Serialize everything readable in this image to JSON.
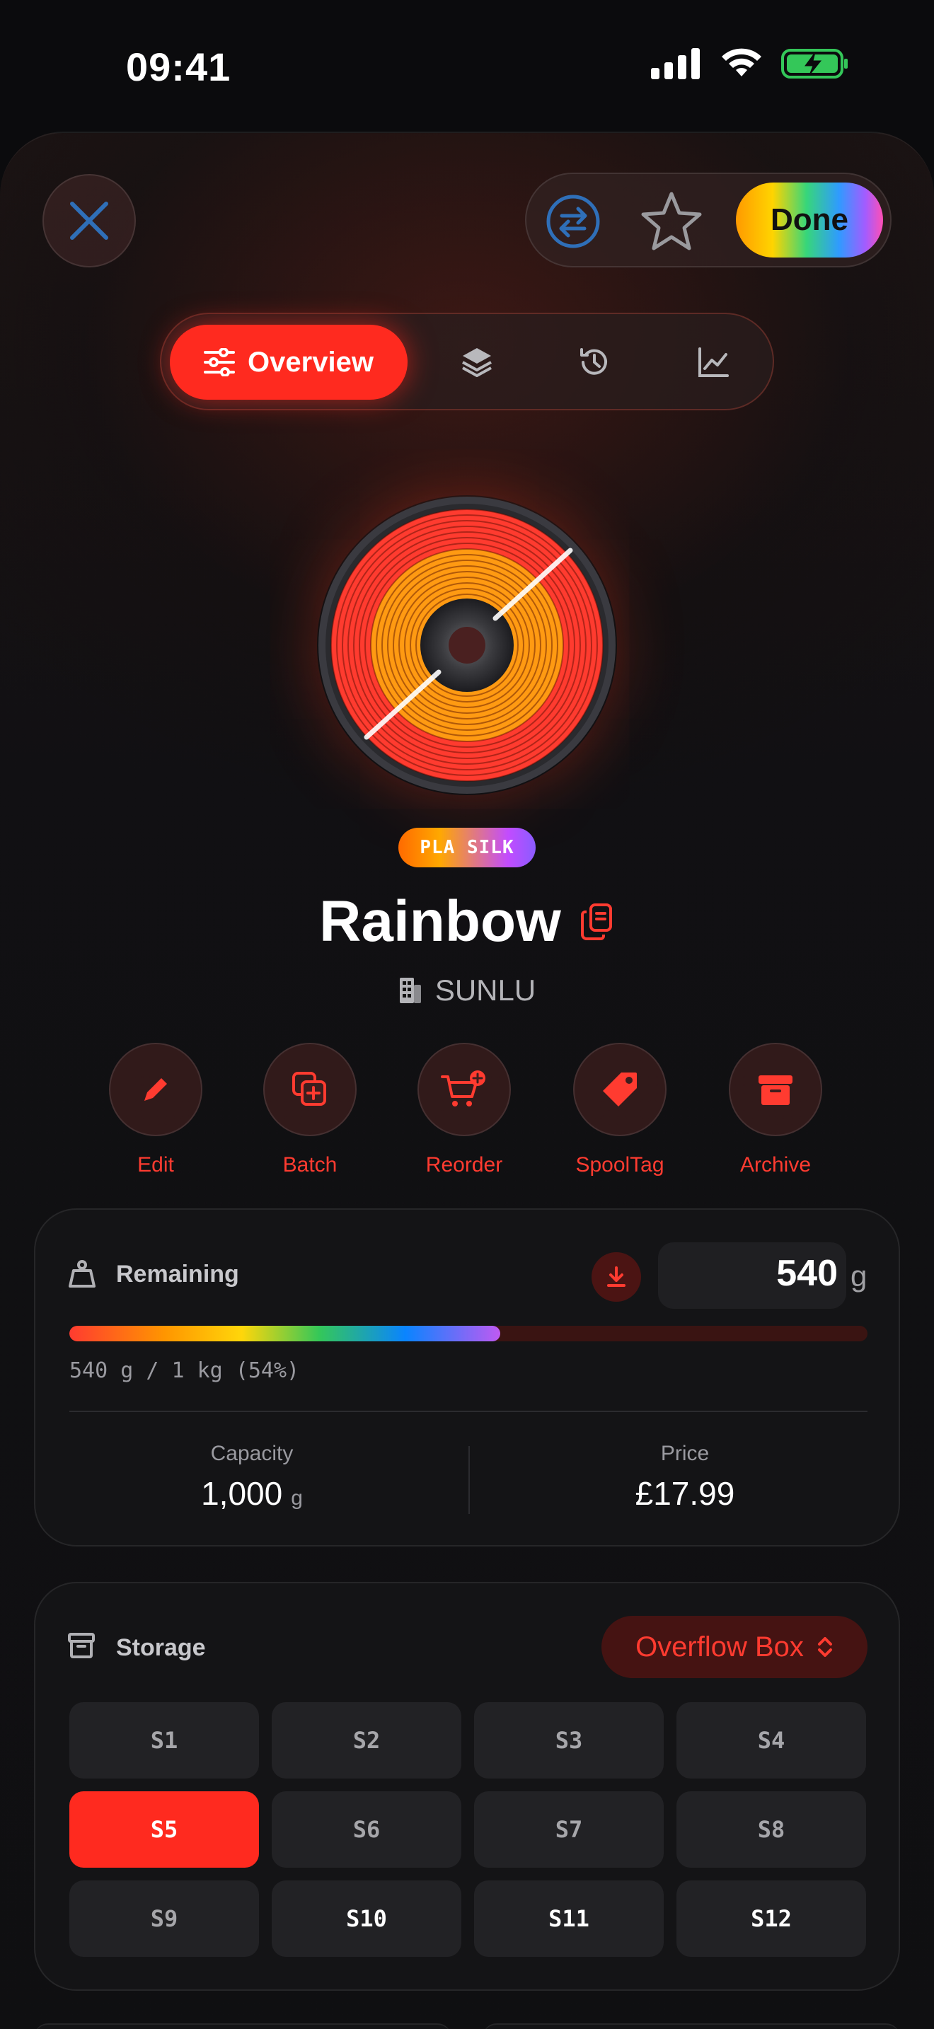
{
  "status_bar": {
    "time": "09:41"
  },
  "header": {
    "done_label": "Done",
    "icons": [
      "close-icon",
      "swap-icon",
      "star-icon"
    ]
  },
  "tabs": [
    {
      "label": "Overview",
      "icon": "sliders-icon",
      "active": true
    },
    {
      "label": "",
      "icon": "layers-icon"
    },
    {
      "label": "",
      "icon": "history-icon"
    },
    {
      "label": "",
      "icon": "chart-icon"
    }
  ],
  "spool": {
    "material": "PLA SILK",
    "name": "Rainbow",
    "brand": "SUNLU",
    "colors": {
      "outer": "#ff3b2f",
      "inner": "#ff9a12",
      "accent": "#ff2a1f"
    }
  },
  "actions": [
    {
      "label": "Edit",
      "icon": "pencil-icon"
    },
    {
      "label": "Batch",
      "icon": "duplicate-plus-icon"
    },
    {
      "label": "Reorder",
      "icon": "cart-plus-icon"
    },
    {
      "label": "SpoolTag",
      "icon": "tag-icon"
    },
    {
      "label": "Archive",
      "icon": "archive-box-icon"
    }
  ],
  "remaining": {
    "label": "Remaining",
    "value": "540",
    "unit": "g",
    "fraction": 0.54,
    "summary": "540 g / 1 kg (54%)",
    "capacity_label": "Capacity",
    "capacity_value": "1,000",
    "capacity_unit": "g",
    "price_label": "Price",
    "price_value": "£17.99"
  },
  "storage": {
    "label": "Storage",
    "location": "Overflow Box",
    "slots": [
      {
        "label": "S1",
        "state": "empty"
      },
      {
        "label": "S2",
        "state": "empty"
      },
      {
        "label": "S3",
        "state": "empty"
      },
      {
        "label": "S4",
        "state": "empty"
      },
      {
        "label": "S5",
        "state": "selected"
      },
      {
        "label": "S6",
        "state": "empty"
      },
      {
        "label": "S7",
        "state": "empty"
      },
      {
        "label": "S8",
        "state": "empty"
      },
      {
        "label": "S9",
        "state": "empty"
      },
      {
        "label": "S10",
        "state": "occupied"
      },
      {
        "label": "S11",
        "state": "occupied"
      },
      {
        "label": "S12",
        "state": "occupied"
      }
    ]
  }
}
